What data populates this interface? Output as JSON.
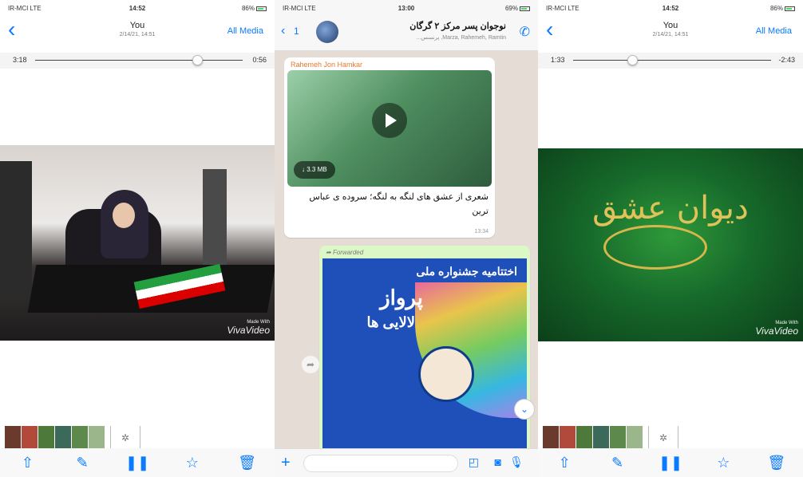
{
  "colors": {
    "ios_blue": "#0a7aff",
    "whatsapp_bg": "#e5ddd5",
    "bubble_out": "#dcf8c6",
    "sender": "#e6792f"
  },
  "left_phone": {
    "status": {
      "carrier": "IR-MCI LTE",
      "time": "14:52",
      "battery": "86%"
    },
    "nav": {
      "back_icon": "chevron-left",
      "title": "You",
      "subtitle": "2/14/21, 14:51",
      "right_label": "All Media"
    },
    "scrubber": {
      "elapsed": "3:18",
      "remaining": "0:56",
      "progress": 0.78
    },
    "watermark": {
      "small": "Made With",
      "brand": "VivaVideo"
    },
    "toolbar": [
      "share-icon",
      "edit-icon",
      "pause-icon",
      "star-icon",
      "trash-icon"
    ]
  },
  "middle_phone": {
    "status": {
      "carrier": "IR-MCI LTE",
      "time": "13:00",
      "battery": "69%"
    },
    "header": {
      "back_count": "1",
      "title": "نوجوان پسر مرکز ۲ گرگان",
      "members": "...پرنسس ,Marza, Rahemeh, Ramtin",
      "call_icon": "phone-plus-icon"
    },
    "messages": [
      {
        "sender": "Rahemeh Jon Hamkar",
        "download_size": "3.3 MB",
        "caption": "شعری از عشق های لنگه به لنگه؛ سروده ی عباس ترین",
        "time": "13:34"
      },
      {
        "forwarded_label": "Forwarded",
        "poster_line1": "اختتامیه جشنواره ملی",
        "poster_line2": "پرواز",
        "poster_line3": "لالایی ها"
      }
    ],
    "input_icons": [
      "plus-icon",
      "sticker-icon",
      "camera-icon",
      "mic-icon"
    ]
  },
  "right_phone": {
    "status": {
      "carrier": "IR-MCI LTE",
      "time": "14:52",
      "battery": "86%"
    },
    "nav": {
      "back_icon": "chevron-left",
      "title": "You",
      "subtitle": "2/14/21, 14:51",
      "right_label": "All Media"
    },
    "scrubber": {
      "elapsed": "1:33",
      "remaining": "-2:43",
      "progress": 0.3
    },
    "artwork_text": "دیوان عشق",
    "watermark": {
      "small": "Made With",
      "brand": "VivaVideo"
    },
    "toolbar": [
      "share-icon",
      "edit-icon",
      "pause-icon",
      "star-icon",
      "trash-icon"
    ]
  }
}
